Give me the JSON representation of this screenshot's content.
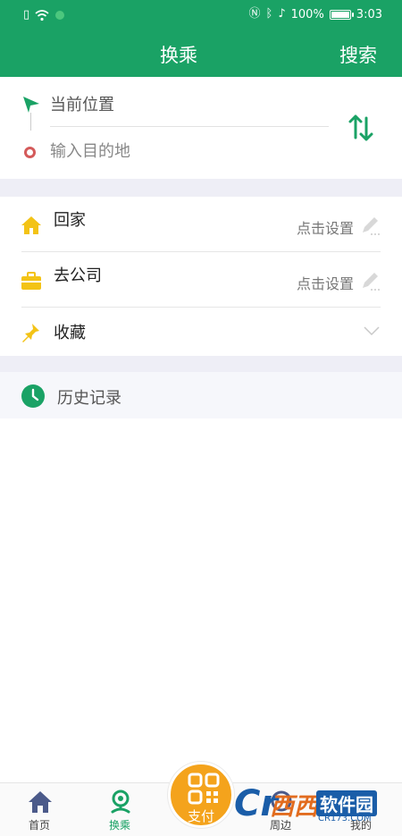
{
  "status_bar": {
    "battery": "100%",
    "time": "3:03"
  },
  "header": {
    "title": "换乘",
    "search_label": "搜索"
  },
  "route": {
    "from_placeholder": "当前位置",
    "to_placeholder": "输入目的地",
    "swap_icon": "swap-vertical-icon"
  },
  "places": [
    {
      "label": "回家",
      "action": "点击设置",
      "icon": "home-icon"
    },
    {
      "label": "去公司",
      "action": "点击设置",
      "icon": "briefcase-icon"
    },
    {
      "label": "收藏",
      "icon": "pin-icon"
    }
  ],
  "history": {
    "label": "历史记录"
  },
  "tabs": [
    {
      "label": "首页",
      "icon": "home-tab-icon"
    },
    {
      "label": "换乘",
      "icon": "transfer-tab-icon",
      "active": true
    },
    {
      "label": "周边",
      "icon": "nearby-tab-icon"
    },
    {
      "label": "我的",
      "icon": "profile-tab-icon"
    }
  ],
  "pay": {
    "label": "支付"
  },
  "watermark": {
    "brand": "西西",
    "soft": "软件园",
    "url": "CR173.COM",
    "letter": "Cr"
  },
  "colors": {
    "brand_green": "#1aa265",
    "pay_orange": "#f4a31c",
    "home_yellow": "#f3c316"
  }
}
